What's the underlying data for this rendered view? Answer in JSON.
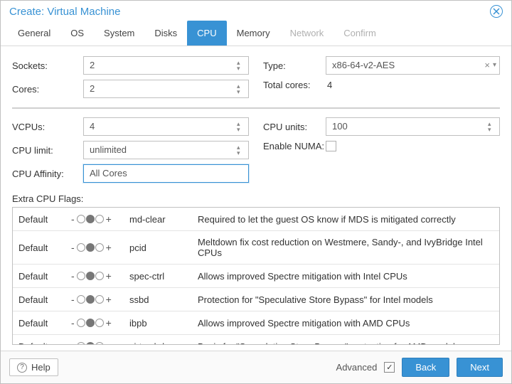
{
  "title": "Create: Virtual Machine",
  "tabs": [
    {
      "label": "General",
      "state": "enabled"
    },
    {
      "label": "OS",
      "state": "enabled"
    },
    {
      "label": "System",
      "state": "enabled"
    },
    {
      "label": "Disks",
      "state": "enabled"
    },
    {
      "label": "CPU",
      "state": "active"
    },
    {
      "label": "Memory",
      "state": "enabled"
    },
    {
      "label": "Network",
      "state": "disabled"
    },
    {
      "label": "Confirm",
      "state": "disabled"
    }
  ],
  "left": {
    "sockets": {
      "label": "Sockets:",
      "value": "2"
    },
    "cores": {
      "label": "Cores:",
      "value": "2"
    },
    "vcpus": {
      "label": "VCPUs:",
      "value": "4"
    },
    "cpu_limit": {
      "label": "CPU limit:",
      "value": "unlimited"
    },
    "cpu_affinity": {
      "label": "CPU Affinity:",
      "value": "All Cores"
    }
  },
  "right": {
    "type": {
      "label": "Type:",
      "value": "x86-64-v2-AES"
    },
    "total_cores": {
      "label": "Total cores:",
      "value": "4"
    },
    "cpu_units": {
      "label": "CPU units:",
      "value": "100"
    },
    "enable_numa": {
      "label": "Enable NUMA:",
      "checked": false
    }
  },
  "extra_flags_label": "Extra CPU Flags:",
  "flag_state_default": "Default",
  "flags": [
    {
      "name": "md-clear",
      "desc": "Required to let the guest OS know if MDS is mitigated correctly"
    },
    {
      "name": "pcid",
      "desc": "Meltdown fix cost reduction on Westmere, Sandy-, and IvyBridge Intel CPUs"
    },
    {
      "name": "spec-ctrl",
      "desc": "Allows improved Spectre mitigation with Intel CPUs"
    },
    {
      "name": "ssbd",
      "desc": "Protection for \"Speculative Store Bypass\" for Intel models"
    },
    {
      "name": "ibpb",
      "desc": "Allows improved Spectre mitigation with AMD CPUs"
    },
    {
      "name": "virt-ssbd",
      "desc": "Basis for \"Speculative Store Bypass\" protection for AMD models"
    }
  ],
  "footer": {
    "help": "Help",
    "advanced": "Advanced",
    "advanced_checked": true,
    "back": "Back",
    "next": "Next"
  }
}
